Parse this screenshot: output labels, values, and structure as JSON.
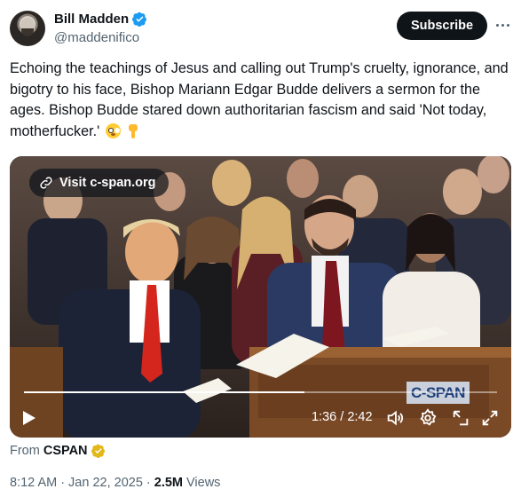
{
  "author": {
    "display_name": "Bill Madden",
    "handle": "@maddenifico",
    "verified_icon": "verified-badge-icon",
    "avatar": "avatar"
  },
  "actions": {
    "subscribe_label": "Subscribe",
    "more_icon": "more-options-icon"
  },
  "tweet": {
    "text": "Echoing the teachings of Jesus and calling out Trump's cruelty, ignorance, and bigotry to his face, Bishop Mariann Edgar Budde delivers a sermon for the ages. Bishop Budde stared down authoritarian fascism and said 'Not today, motherfucker.'",
    "emojis": [
      "flushed-face-emoji",
      "pointing-down-emoji"
    ]
  },
  "media": {
    "visit_label": "Visit c-spa‌n.org",
    "channel_logo": "C-SPAN",
    "current_time": "1:36",
    "separator": "/",
    "duration": "2:42",
    "progress_fraction": 0.593,
    "icons": [
      "play-icon",
      "volume-icon",
      "settings-icon",
      "picture-in-picture-icon",
      "fullscreen-icon"
    ]
  },
  "source": {
    "prefix": "From",
    "name": "CSPAN",
    "badge_icon": "gold-verified-badge-icon"
  },
  "meta": {
    "time": "8:12 AM",
    "dot1": "·",
    "date": "Jan 22, 2025",
    "dot2": "·",
    "views_count": "2.5M",
    "views_label": "Views"
  },
  "colors": {
    "text": "#0f1419",
    "secondary": "#536471",
    "verified_blue": "#1d9bf0",
    "gold": "#e2b719"
  }
}
